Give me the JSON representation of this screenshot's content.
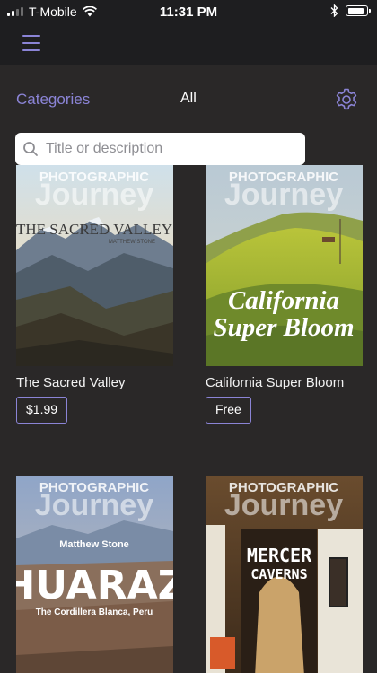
{
  "status_bar": {
    "carrier": "T-Mobile",
    "time": "11:31 PM",
    "signal_bars": 2,
    "battery_level": 0.9
  },
  "nav": {
    "menu_icon": "hamburger-icon"
  },
  "filter": {
    "categories_label": "Categories",
    "current_filter": "All",
    "settings_icon": "gear-icon"
  },
  "search": {
    "placeholder": "Title or description",
    "value": ""
  },
  "colors": {
    "accent": "#8b84d6",
    "background": "#2a2828",
    "bar": "#1e1e20"
  },
  "books": [
    {
      "title": "The Sacred Valley",
      "price": "$1.99",
      "cover": {
        "masthead_top": "PHOTOGRAPHIC",
        "masthead_main": "Journey",
        "headline": "THE SACRED VALLEY",
        "author": "MATTHEW STONE"
      }
    },
    {
      "title": "California Super Bloom",
      "price": "Free",
      "cover": {
        "masthead_top": "PHOTOGRAPHIC",
        "masthead_main": "Journey",
        "headline_line1": "California",
        "headline_line2": "Super Bloom"
      }
    },
    {
      "title": "",
      "price": "",
      "cover": {
        "masthead_top": "PHOTOGRAPHIC",
        "masthead_main": "Journey",
        "author": "Matthew Stone",
        "headline": "HUARAZ",
        "subtitle": "The Cordillera Blanca, Peru"
      }
    },
    {
      "title": "",
      "price": "",
      "cover": {
        "masthead_top": "PHOTOGRAPHIC",
        "masthead_main": "Journey",
        "headline_line1": "MERCER",
        "headline_line2": "CAVERNS"
      }
    }
  ]
}
